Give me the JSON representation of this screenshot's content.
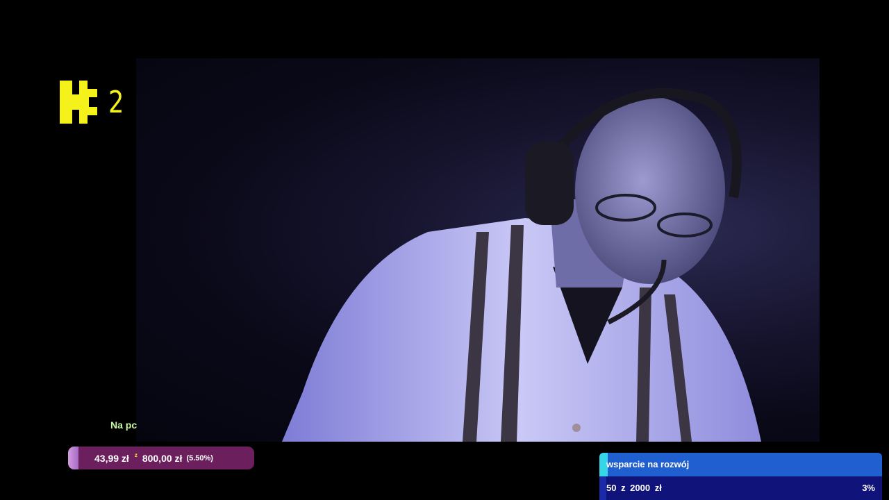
{
  "logo": {
    "number": "2"
  },
  "ticker": {
    "text": "Na pc"
  },
  "donation": {
    "current": "43,99 zł",
    "separator": "z",
    "goal": "800,00 zł",
    "percent_label": "(5.50%)",
    "progress": 0.055
  },
  "support_goal": {
    "title": "wsparcie na rozwój",
    "amount": "50 z 2000 zł",
    "percent_label": "3%",
    "progress": 0.025
  },
  "colors": {
    "logo_yellow": "#f4f21a",
    "donation_bar": "#6b1f5c",
    "support_title": "#1f5fcf",
    "support_accent": "#35d6e8",
    "support_progress": "#10137a"
  }
}
